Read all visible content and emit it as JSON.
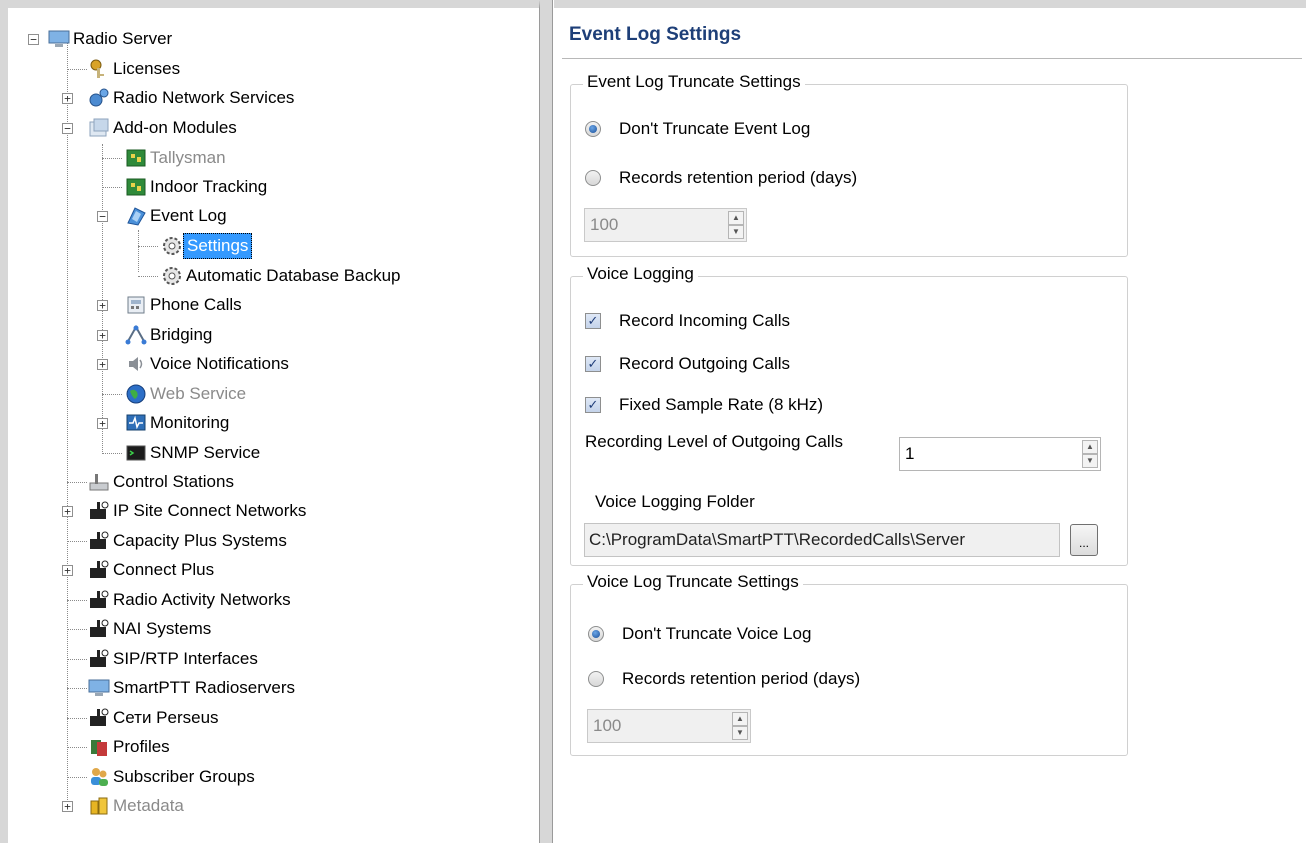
{
  "tree": {
    "items": [
      {
        "label": "Radio Server",
        "icon": "computer-icon"
      },
      {
        "label": "Licenses",
        "icon": "keys-icon"
      },
      {
        "label": "Radio Network Services",
        "icon": "network-gears-icon"
      },
      {
        "label": "Add-on Modules",
        "icon": "modules-icon"
      },
      {
        "label": "Tallysman",
        "icon": "circuit-board-icon"
      },
      {
        "label": "Indoor Tracking",
        "icon": "circuit-board-icon"
      },
      {
        "label": "Event Log",
        "icon": "event-log-icon"
      },
      {
        "label": "Settings",
        "icon": "gear-icon"
      },
      {
        "label": "Automatic Database Backup",
        "icon": "gear-icon"
      },
      {
        "label": "Phone Calls",
        "icon": "phone-icon"
      },
      {
        "label": "Bridging",
        "icon": "bridging-icon"
      },
      {
        "label": "Voice Notifications",
        "icon": "speaker-icon"
      },
      {
        "label": "Web Service",
        "icon": "globe-icon"
      },
      {
        "label": "Monitoring",
        "icon": "monitoring-icon"
      },
      {
        "label": "SNMP Service",
        "icon": "terminal-icon"
      },
      {
        "label": "Control Stations",
        "icon": "control-station-icon"
      },
      {
        "label": "IP Site Connect Networks",
        "icon": "radio-network-icon"
      },
      {
        "label": "Capacity Plus Systems",
        "icon": "radio-network-icon"
      },
      {
        "label": "Connect Plus",
        "icon": "radio-network-icon"
      },
      {
        "label": "Radio Activity Networks",
        "icon": "radio-network-icon"
      },
      {
        "label": "NAI Systems",
        "icon": "radio-network-icon"
      },
      {
        "label": "SIP/RTP Interfaces",
        "icon": "radio-network-icon"
      },
      {
        "label": "SmartPTT Radioservers",
        "icon": "computer-icon"
      },
      {
        "label": "Сети Perseus",
        "icon": "radio-network-icon"
      },
      {
        "label": "Profiles",
        "icon": "profiles-icon"
      },
      {
        "label": "Subscriber Groups",
        "icon": "users-icon"
      },
      {
        "label": "Metadata",
        "icon": "database-icon"
      }
    ]
  },
  "settings": {
    "title": "Event Log Settings",
    "event_truncate": {
      "legend": "Event Log Truncate Settings",
      "opt_dont": "Don't Truncate Event Log",
      "opt_retention": "Records retention period (days)",
      "days_value": "100"
    },
    "voice_logging": {
      "legend": "Voice Logging",
      "record_incoming": "Record Incoming Calls",
      "record_outgoing": "Record Outgoing Calls",
      "fixed_rate": "Fixed Sample Rate (8 kHz)",
      "recording_level_label": "Recording Level of Outgoing Calls",
      "recording_level_value": "1",
      "folder_label": "Voice Logging Folder",
      "folder_value": "C:\\ProgramData\\SmartPTT\\RecordedCalls\\Server",
      "browse_label": "..."
    },
    "voice_truncate": {
      "legend": "Voice Log Truncate Settings",
      "opt_dont": "Don't Truncate Voice Log",
      "opt_retention": "Records retention period (days)",
      "days_value": "100"
    }
  },
  "colors": {
    "title": "#1e3f78",
    "selection": "#3399ff",
    "panel_border": "#d7d7d7"
  }
}
